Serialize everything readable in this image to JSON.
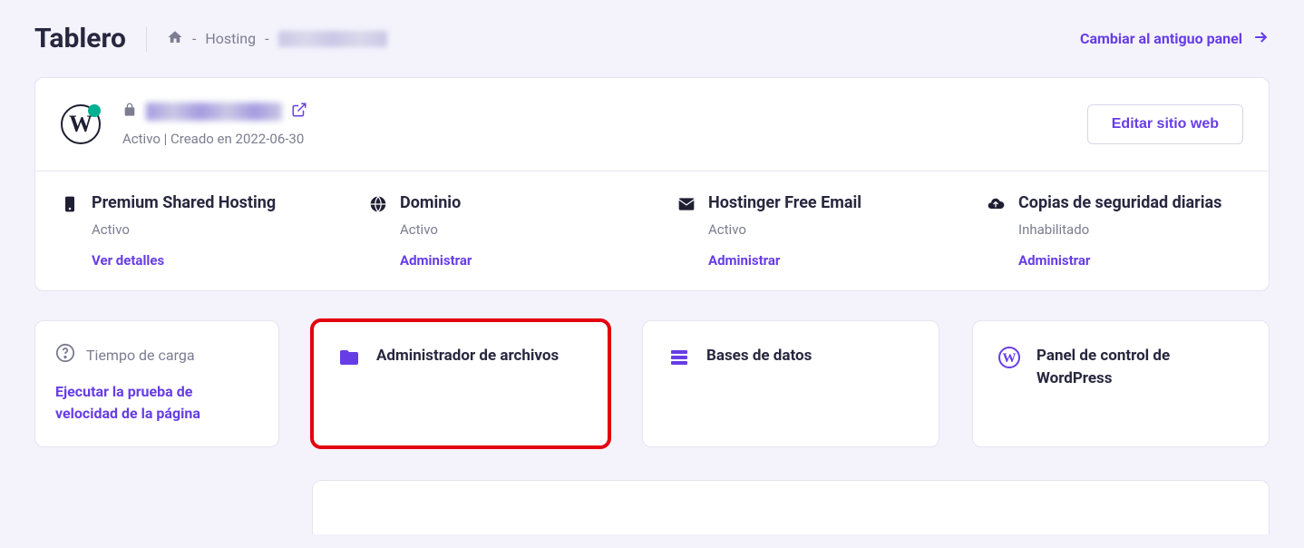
{
  "header": {
    "title": "Tablero",
    "breadcrumb": {
      "label": "Hosting"
    },
    "switch_label": "Cambiar al antiguo panel"
  },
  "site": {
    "status_line": "Activo | Creado en 2022-06-30",
    "edit_button": "Editar sitio web"
  },
  "info": [
    {
      "title": "Premium Shared Hosting",
      "status": "Activo",
      "link": "Ver detalles"
    },
    {
      "title": "Dominio",
      "status": "Activo",
      "link": "Administrar"
    },
    {
      "title": "Hostinger Free Email",
      "status": "Activo",
      "link": "Administrar"
    },
    {
      "title": "Copias de seguridad diarias",
      "status": "Inhabilitado",
      "link": "Administrar"
    }
  ],
  "side": {
    "heading": "Tiempo de carga",
    "link": "Ejecutar la prueba de velocidad de la página"
  },
  "tools": [
    {
      "label": "Administrador de archivos",
      "icon": "folder",
      "highlight": true
    },
    {
      "label": "Bases de datos",
      "icon": "db",
      "highlight": false
    },
    {
      "label": "Panel de control de WordPress",
      "icon": "wp",
      "highlight": false
    }
  ],
  "colors": {
    "accent": "#673de6",
    "highlight": "#e3000f"
  }
}
